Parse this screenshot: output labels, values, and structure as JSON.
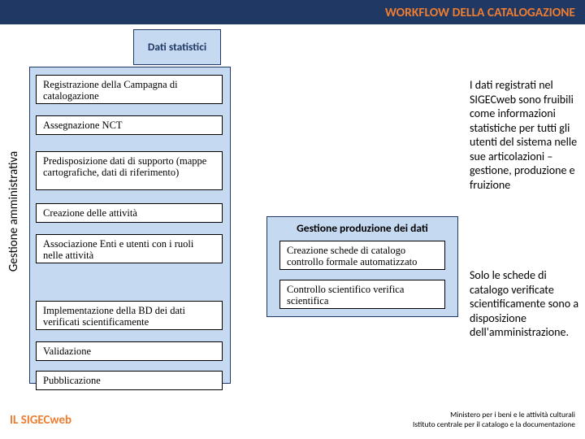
{
  "header": {
    "title": "WORKFLOW DELLA CATALOGAZIONE"
  },
  "dati": {
    "label": "Dati statistici"
  },
  "vlabel": "Gestione amministrativa",
  "steps": {
    "s1": "Registrazione della Campagna di catalogazione",
    "s2": "Assegnazione NCT",
    "s3": "Predisposizione dati di supporto (mappe cartografiche, dati di riferimento)",
    "s4": "Creazione delle attività",
    "s5": "Associazione Enti e utenti con i ruoli nelle attività",
    "s6": "Implementazione della BD dei dati verificati scientificamente",
    "s7": "Validazione",
    "s8": "Pubblicazione"
  },
  "rightGroup": {
    "title": "Gestione produzione dei dati",
    "r1": "Creazione schede di catalogo controllo formale automatizzato",
    "r2": "Controllo scientifico verifica scientifica"
  },
  "desc": {
    "p1": "I dati registrati nel SIGECweb sono fruibili come informazioni statistiche per tutti gli utenti del sistema nelle sue articolazioni – gestione, produzione e fruizione",
    "p2": "Solo le schede di catalogo verificate scientificamente sono a disposizione dell'amministrazione."
  },
  "footer": {
    "left": "IL SIGECweb",
    "r1": "Ministero per i beni e le attività culturali",
    "r2": "Istituto centrale per il catalogo e la documentazione"
  }
}
